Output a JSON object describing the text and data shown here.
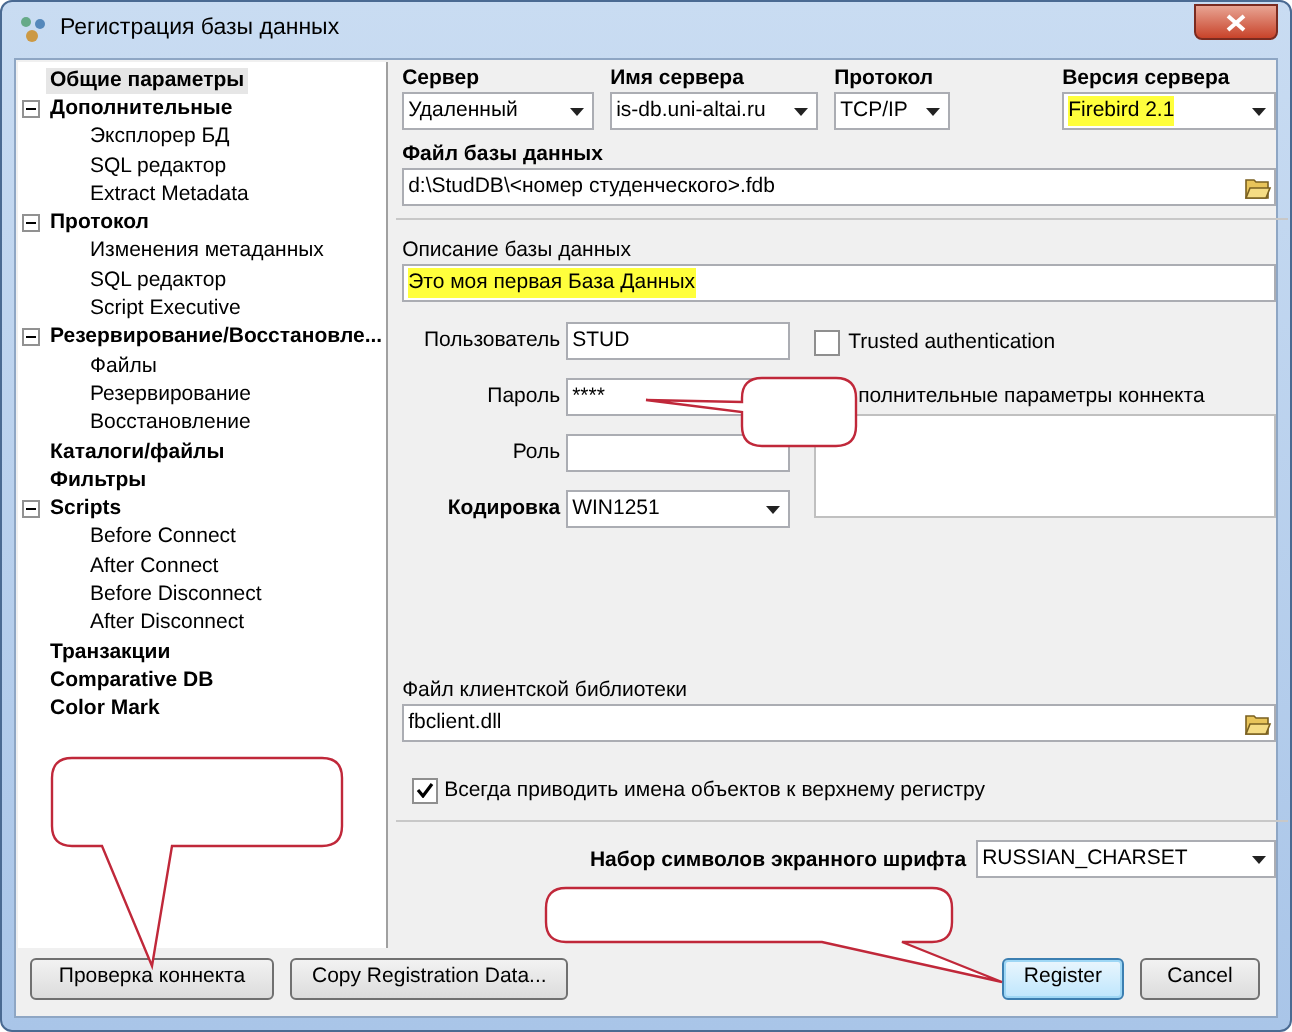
{
  "window": {
    "title": "Регистрация базы данных"
  },
  "tree": [
    {
      "label": "Общие параметры",
      "selected": true
    },
    {
      "label": "Дополнительные",
      "selected": false,
      "expanded": true,
      "children": [
        {
          "label": "Эксплорер БД",
          "selected": false
        },
        {
          "label": "SQL редактор",
          "selected": false
        },
        {
          "label": "Extract Metadata",
          "selected": false
        }
      ]
    },
    {
      "label": "Протокол",
      "selected": false,
      "expanded": true,
      "children": [
        {
          "label": "Изменения метаданных",
          "selected": false
        },
        {
          "label": "SQL редактор",
          "selected": false
        },
        {
          "label": "Script Executive",
          "selected": false
        }
      ]
    },
    {
      "label": "Резервирование/Восстановле...",
      "selected": false,
      "expanded": true,
      "children": [
        {
          "label": "Файлы",
          "selected": false
        },
        {
          "label": "Резервирование",
          "selected": false
        },
        {
          "label": "Восстановление",
          "selected": false
        }
      ]
    },
    {
      "label": "Каталоги/файлы",
      "selected": false
    },
    {
      "label": "Фильтры",
      "selected": false
    },
    {
      "label": "Scripts",
      "selected": false,
      "expanded": true,
      "children": [
        {
          "label": "Before Connect",
          "selected": false
        },
        {
          "label": "After Connect",
          "selected": false
        },
        {
          "label": "Before Disconnect",
          "selected": false
        },
        {
          "label": "After Disconnect",
          "selected": false
        }
      ]
    },
    {
      "label": "Транзакции",
      "selected": false
    },
    {
      "label": "Comparative DB",
      "selected": false
    },
    {
      "label": "Color Mark",
      "selected": false
    }
  ],
  "server_fields": [
    {
      "label": "Сервер",
      "value": "Удаленный",
      "highlighted": false
    },
    {
      "label": "Имя сервера",
      "value": "is-db.uni-altai.ru",
      "highlighted": false
    },
    {
      "label": "Протокол",
      "value": "TCP/IP",
      "highlighted": false
    },
    {
      "label": "Версия сервера",
      "value": "Firebird 2.1",
      "highlighted": true
    }
  ],
  "database_file": {
    "label": "Файл базы данных",
    "value": "d:\\StudDB\\<номер студенческого>.fdb"
  },
  "description": {
    "label": "Описание базы данных",
    "value": "Это моя первая База Данных",
    "highlighted": true
  },
  "credentials": [
    {
      "label": "Пользователь",
      "value": "STUD",
      "kind": "text"
    },
    {
      "label": "Пароль",
      "value": "****",
      "kind": "text"
    },
    {
      "label": "Роль",
      "kind": "text"
    },
    {
      "label": "Кодировка",
      "value": "WIN1251",
      "kind": "select"
    }
  ],
  "trusted_authentication": {
    "label": "Trusted authentication",
    "checked": false
  },
  "extra_params": {
    "label": "полнительные параметры коннекта"
  },
  "client_library": {
    "label": "Файл клиентской библиотеки",
    "value": "fbclient.dll"
  },
  "uppercase_names": {
    "label": "Всегда приводить имена объектов к верхнему регистру",
    "checked": true
  },
  "screen_charset": {
    "label": "Набор символов экранного шрифта",
    "value": "RUSSIAN_CHARSET"
  },
  "buttons": [
    {
      "label": "Проверка коннекта",
      "kind": "left",
      "default": false
    },
    {
      "label": "Copy Registration Data...",
      "kind": "left",
      "default": false
    },
    {
      "label": "Register",
      "kind": "right",
      "default": true
    },
    {
      "label": "Cancel",
      "kind": "right",
      "default": false
    }
  ]
}
